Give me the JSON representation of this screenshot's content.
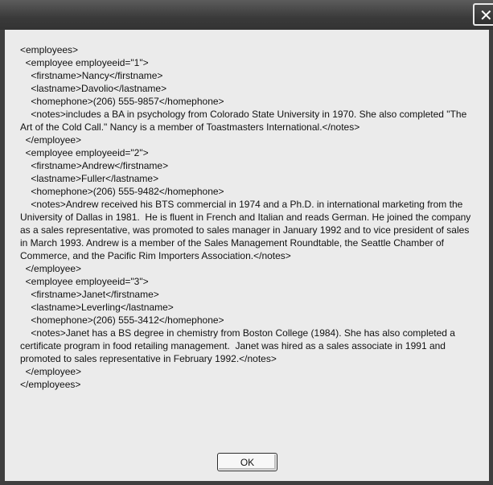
{
  "titlebar": {
    "close_label": "✕"
  },
  "content": {
    "xml_text": "<employees>\n  <employee employeeid=\"1\">\n    <firstname>Nancy</firstname>\n    <lastname>Davolio</lastname>\n    <homephone>(206) 555-9857</homephone>\n    <notes>includes a BA in psychology from Colorado State University in 1970. She also completed \"The Art of the Cold Call.\" Nancy is a member of Toastmasters International.</notes>\n  </employee>\n  <employee employeeid=\"2\">\n    <firstname>Andrew</firstname>\n    <lastname>Fuller</lastname>\n    <homephone>(206) 555-9482</homephone>\n    <notes>Andrew received his BTS commercial in 1974 and a Ph.D. in international marketing from the University of Dallas in 1981.  He is fluent in French and Italian and reads German. He joined the company as a sales representative, was promoted to sales manager in January 1992 and to vice president of sales in March 1993. Andrew is a member of the Sales Management Roundtable, the Seattle Chamber of Commerce, and the Pacific Rim Importers Association.</notes>\n  </employee>\n  <employee employeeid=\"3\">\n    <firstname>Janet</firstname>\n    <lastname>Leverling</lastname>\n    <homephone>(206) 555-3412</homephone>\n    <notes>Janet has a BS degree in chemistry from Boston College (1984). She has also completed a certificate program in food retailing management.  Janet was hired as a sales associate in 1991 and promoted to sales representative in February 1992.</notes>\n  </employee>\n</employees>"
  },
  "buttons": {
    "ok_label": "OK"
  }
}
